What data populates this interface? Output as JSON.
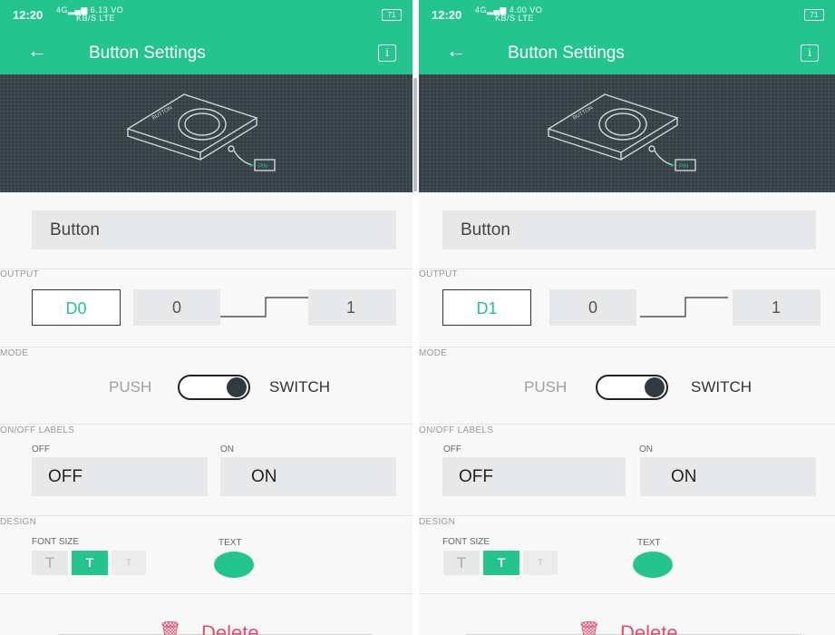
{
  "accent_color": "#23c48e",
  "delete_color": "#e44b6a",
  "hero_icon": "button-widget-illustration",
  "panels": [
    {
      "status": {
        "time": "12:20",
        "signal": "4G",
        "speed_top": "6.13",
        "speed_bottom": "KB/S",
        "net_top": "VO",
        "net_bottom": "LTE",
        "battery": "71"
      },
      "title": "Button Settings",
      "info_label": "i",
      "illustration": {
        "button_text": "BUTTON",
        "pin_text": "PIN"
      },
      "name_value": "Button",
      "output": {
        "section": "OUTPUT",
        "pin": "D0",
        "low": "0",
        "high": "1"
      },
      "mode": {
        "section": "MODE",
        "push": "PUSH",
        "switch": "SWITCH",
        "selected": "SWITCH"
      },
      "labels": {
        "section": "ON/OFF LABELS",
        "off_caption": "OFF",
        "on_caption": "ON",
        "off_value": "OFF",
        "on_value": "ON"
      },
      "design": {
        "section": "DESIGN",
        "font_size": "FONT SIZE",
        "sizes": [
          "T",
          "T",
          "T"
        ],
        "selected_size_index": 1,
        "text_caption": "TEXT"
      },
      "delete_label": "Delete"
    },
    {
      "status": {
        "time": "12:20",
        "signal": "4G",
        "speed_top": "4.00",
        "speed_bottom": "KB/S",
        "net_top": "VO",
        "net_bottom": "LTE",
        "battery": "71"
      },
      "title": "Button Settings",
      "info_label": "i",
      "illustration": {
        "button_text": "BUTTON",
        "pin_text": "PIN"
      },
      "name_value": "Button",
      "output": {
        "section": "OUTPUT",
        "pin": "D1",
        "low": "0",
        "high": "1"
      },
      "mode": {
        "section": "MODE",
        "push": "PUSH",
        "switch": "SWITCH",
        "selected": "SWITCH"
      },
      "labels": {
        "section": "ON/OFF LABELS",
        "off_caption": "OFF",
        "on_caption": "ON",
        "off_value": "OFF",
        "on_value": "ON"
      },
      "design": {
        "section": "DESIGN",
        "font_size": "FONT SIZE",
        "sizes": [
          "T",
          "T",
          "T"
        ],
        "selected_size_index": 1,
        "text_caption": "TEXT"
      },
      "delete_label": "Delete"
    }
  ]
}
